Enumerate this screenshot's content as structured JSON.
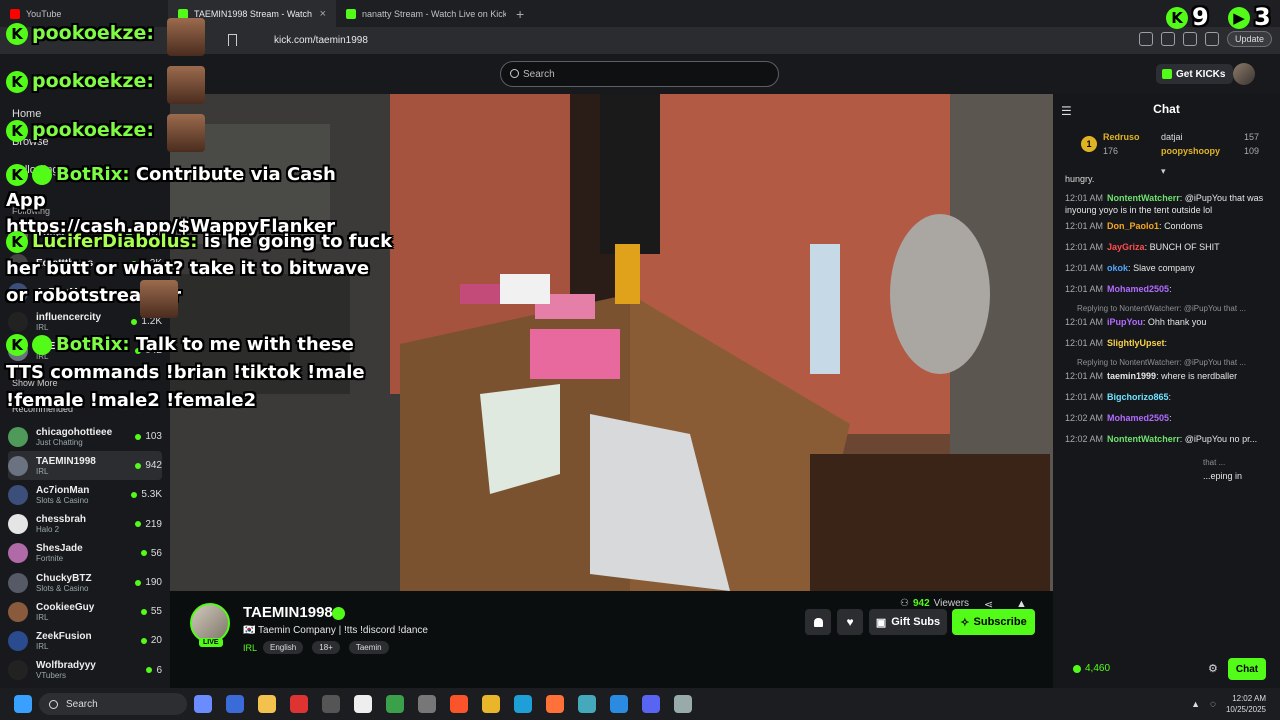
{
  "browser": {
    "tabs": [
      {
        "label": "YouTube",
        "favicon_color": "#ff0000"
      },
      {
        "label": "TAEMIN1998 Stream - Watch",
        "favicon_color": "#53fc18"
      },
      {
        "label": "nanatty Stream - Watch Live on Kick",
        "favicon_color": "#53fc18"
      }
    ],
    "url": "kick.com/taemin1998",
    "update_label": "Update",
    "tab_close": "×",
    "new_tab": "+"
  },
  "overlay": {
    "scoreboard": {
      "first": "9",
      "second": "3"
    },
    "lines": [
      {
        "user": "pookoekze:",
        "text": ""
      },
      {
        "user": "pookoekze:",
        "text": ""
      },
      {
        "user": "pookoekze:",
        "text": ""
      },
      {
        "user": "BotRix:",
        "text": "Contribute via Cash App https://cash.app/$WappyFlanker"
      },
      {
        "user": "LuciferDiabolus:",
        "text": "is he going to fuck her butt or what? take it to bitwave or robotstreamer"
      },
      {
        "user": "BotRix:",
        "text": "Talk to me with these TTS commands !brian !tiktok !male !female !male2 !female2"
      }
    ]
  },
  "site": {
    "search_placeholder": "Search",
    "get_kicks": "Get KICKs",
    "nav": [
      {
        "label": "Home"
      },
      {
        "label": "Browse"
      },
      {
        "label": "Following"
      }
    ],
    "following_title": "Following",
    "following": [
      {
        "name": "Cuffem",
        "category": "",
        "viewers": "13.1K"
      },
      {
        "name": "Edrattthews",
        "category": "",
        "viewers": "6.2K"
      },
      {
        "name": "Ac7ionMan",
        "category": "",
        "viewers": ""
      },
      {
        "name": "influencercity",
        "category": "IRL",
        "viewers": "1.2K"
      },
      {
        "name": "TAEMIN1998",
        "category": "IRL",
        "viewers": "942"
      }
    ],
    "show_more": "Show More",
    "recommended_title": "Recommended",
    "recommended": [
      {
        "name": "chicagohottieee",
        "category": "Just Chatting",
        "viewers": "103",
        "color": "#4f9a5a"
      },
      {
        "name": "TAEMIN1998",
        "category": "IRL",
        "viewers": "942",
        "color": "#6b7280"
      },
      {
        "name": "Ac7ionMan",
        "category": "Slots & Casino",
        "viewers": "5.3K",
        "color": "#3b4f7a"
      },
      {
        "name": "chessbrah",
        "category": "Halo 2",
        "viewers": "219",
        "color": "#e5e5e5"
      },
      {
        "name": "ShesJade",
        "category": "Fortnite",
        "viewers": "56",
        "color": "#b06aa8"
      },
      {
        "name": "ChuckyBTZ",
        "category": "Slots & Casino",
        "viewers": "190",
        "color": "#555a66"
      },
      {
        "name": "CookieeGuy",
        "category": "IRL",
        "viewers": "55",
        "color": "#8a5a3c"
      },
      {
        "name": "ZeekFusion",
        "category": "IRL",
        "viewers": "20",
        "color": "#2a4b8d"
      },
      {
        "name": "Wolfbradyyy",
        "category": "VTubers",
        "viewers": "6",
        "color": "#222"
      }
    ]
  },
  "stream": {
    "channel": "TAEMIN1998",
    "title": "🇰🇷 Taemin Company | !tts !discord !dance",
    "category": "IRL",
    "tags": [
      "English",
      "18+",
      "Taemin"
    ],
    "live_badge": "LIVE",
    "viewers": "942",
    "viewers_label": "Viewers",
    "gift_subs": "Gift Subs",
    "subscribe": "Subscribe"
  },
  "chat": {
    "title": "Chat",
    "leaderboard": [
      {
        "rank": "1",
        "name": "Redruso",
        "count": "176"
      },
      {
        "name": "datjai",
        "count": "157"
      },
      {
        "name": "poopyshoopy",
        "count": "109"
      }
    ],
    "top_cut": "hungry.",
    "messages": [
      {
        "time": "12:01 AM",
        "user": "NontentWatcherr",
        "color": "#6ee26e",
        "text": "@iPupYou that was inyoung yoyo is in the tent outside lol"
      },
      {
        "time": "12:01 AM",
        "user": "Don_Paolo1",
        "color": "#f5a623",
        "text": "Condoms"
      },
      {
        "time": "12:01 AM",
        "user": "JayGriza",
        "color": "#ff4d4d",
        "text": "BUNCH OF SHIT"
      },
      {
        "time": "12:01 AM",
        "user": "okok",
        "color": "#4da6ff",
        "text": "Slave company"
      },
      {
        "time": "12:01 AM",
        "user": "Mohamed2505",
        "color": "#b26bff",
        "text": ""
      },
      {
        "time": "12:01 AM",
        "user": "iPupYou",
        "color": "#b26bff",
        "text": "Ohh thank you",
        "reply": "Replying to NontentWatcherr: @iPupYou that ..."
      },
      {
        "time": "12:01 AM",
        "user": "SlightlyUpset",
        "color": "#f7d24a",
        "text": ""
      },
      {
        "time": "12:01 AM",
        "user": "taemin1999",
        "color": "#e6e6e6",
        "text": "where is nerdballer",
        "reply": "Replying to NontentWatcherr: @iPupYou that ..."
      },
      {
        "time": "12:01 AM",
        "user": "Bigchorizo865",
        "color": "#6ee2ff",
        "text": ""
      },
      {
        "time": "12:02 AM",
        "user": "Mohamed2505",
        "color": "#b26bff",
        "text": ""
      },
      {
        "time": "12:02 AM",
        "user": "NontentWatcherr",
        "color": "#6ee26e",
        "text": "@iPupYou no pr..."
      }
    ],
    "tail_reply": "that ...",
    "tail_text": "...eping in",
    "balance": "4,460",
    "chat_button": "Chat"
  },
  "taskbar": {
    "search": "Search",
    "time": "12:02 AM",
    "date": "10/25/2025"
  }
}
